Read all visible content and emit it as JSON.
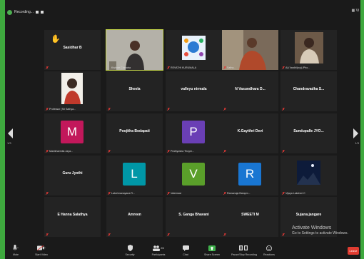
{
  "colors": {
    "active_speaker": "#c5d64a",
    "leave": "#e03c31",
    "taskbar": "#3ea93e"
  },
  "topbar": {
    "recording_label": "Recording...",
    "view_label": "Vi"
  },
  "nav": {
    "left_page": "1/3",
    "right_page": "1/3"
  },
  "tiles": [
    {
      "name": "Sasidhar B",
      "label": "",
      "icon": "raised-hand-icon"
    },
    {
      "name": "",
      "label": "Kishore Chandra"
    },
    {
      "name": "",
      "label": "REVATHI KURUMALA"
    },
    {
      "name": "",
      "label": "Satha..."
    },
    {
      "name": "",
      "label": "AA Vardhi(rcy)-iPho..."
    },
    {
      "name": "",
      "label": "Professor (Sri Sathya..."
    },
    {
      "name": "Sheela",
      "label": ""
    },
    {
      "name": "valleyu nirmala",
      "label": ""
    },
    {
      "name": "N Vasundhara D...",
      "label": ""
    },
    {
      "name": "Chandravadha S...",
      "label": ""
    },
    {
      "name": "",
      "label": "Manikharmila Jaya...",
      "avatar": "M",
      "color": "#c2185b"
    },
    {
      "name": "Poojitha Bodapati",
      "label": ""
    },
    {
      "name": "",
      "label": "Prathyusha Thoym...",
      "avatar": "P",
      "color": "#6a3fb5"
    },
    {
      "name": "K.Gayithri Devi",
      "label": ""
    },
    {
      "name": "Sundupalle JYO...",
      "label": ""
    },
    {
      "name": "Guru Jyothi",
      "label": ""
    },
    {
      "name": "",
      "label": "Lakshmanayana R...",
      "avatar": "L",
      "color": "#0097a7"
    },
    {
      "name": "",
      "label": "Vaishnavi",
      "avatar": "V",
      "color": "#5a9f2a"
    },
    {
      "name": "",
      "label": "Ramanuja Balupm...",
      "avatar": "R",
      "color": "#1976d2"
    },
    {
      "name": "",
      "label": "Vijaya Lakshmi C"
    },
    {
      "name": "E Hanna Salathya",
      "label": ""
    },
    {
      "name": "Amreen",
      "label": ""
    },
    {
      "name": "S. Ganga Bhavani",
      "label": ""
    },
    {
      "name": "SWEETI M",
      "label": ""
    },
    {
      "name": "Sujana.jangare",
      "label": ""
    }
  ],
  "watermark": {
    "line1": "Activate Windows",
    "line2": "Go to Settings to activate Windows."
  },
  "toolbar": {
    "items": [
      {
        "label": "Mute",
        "icon": "microphone-icon"
      },
      {
        "label": "Start Video",
        "icon": "video-camera-icon"
      },
      {
        "label": "Security",
        "icon": "shield-icon"
      },
      {
        "label": "Participants",
        "icon": "participants-icon",
        "count": "26"
      },
      {
        "label": "Chat",
        "icon": "chat-icon"
      },
      {
        "label": "Share Screen",
        "icon": "share-screen-icon"
      },
      {
        "label": "Pause/Stop Recording",
        "icon": "recording-icon"
      },
      {
        "label": "Reactions",
        "icon": "reactions-icon"
      }
    ],
    "leave": "Leave"
  }
}
